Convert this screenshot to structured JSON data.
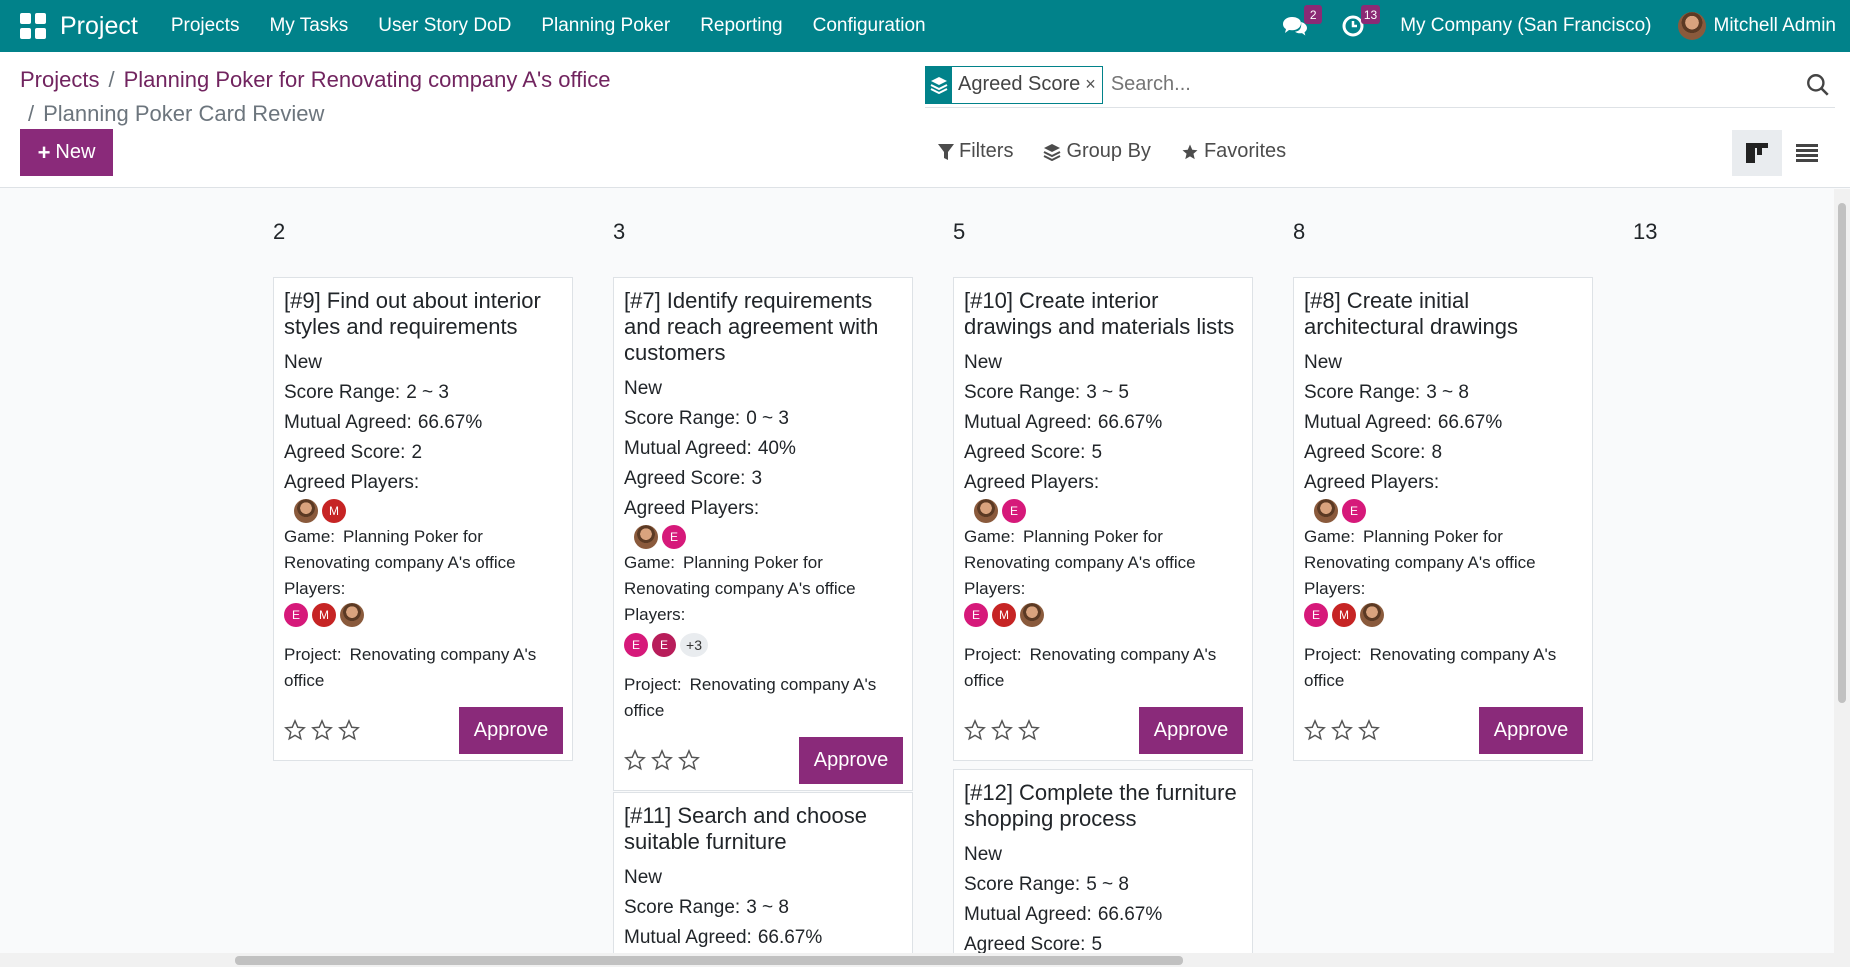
{
  "navbar": {
    "brand": "Project",
    "menu": [
      "Projects",
      "My Tasks",
      "User Story DoD",
      "Planning Poker",
      "Reporting",
      "Configuration"
    ],
    "messages_count": "2",
    "activities_count": "13",
    "company": "My Company (San Francisco)",
    "user": "Mitchell Admin"
  },
  "breadcrumb": {
    "root": "Projects",
    "parent": "Planning Poker for Renovating company A's office",
    "current": "Planning Poker Card Review"
  },
  "toolbar": {
    "new_label": "New"
  },
  "search": {
    "facet_label": "Agreed Score",
    "placeholder": "Search..."
  },
  "filters": {
    "filters": "Filters",
    "group_by": "Group By",
    "favorites": "Favorites"
  },
  "labels": {
    "score_range": "Score Range:",
    "mutual_agreed": "Mutual Agreed:",
    "agreed_score": "Agreed Score:",
    "agreed_players": "Agreed Players:",
    "game": "Game:",
    "players": "Players:",
    "project": "Project:",
    "approve": "Approve"
  },
  "columns": [
    {
      "title": "2",
      "cards": [
        {
          "title": "[#9] Find out about interior styles and requirements",
          "stage": "New",
          "score_range": "2 ~ 3",
          "mutual_agreed": "66.67%",
          "agreed_score": "2",
          "game_value": "Planning Poker for",
          "game_value2": "Renovating company A's office",
          "project_value": "Renovating company A's",
          "project_value2": "office"
        }
      ]
    },
    {
      "title": "3",
      "cards": [
        {
          "title": "[#7] Identify requirements and reach agreement with customers",
          "stage": "New",
          "score_range": "0 ~ 3",
          "mutual_agreed": "40%",
          "agreed_score": "3",
          "game_value": "Planning Poker for",
          "game_value2": "Renovating company A's office",
          "players_more": "+3",
          "project_value": "Renovating company A's",
          "project_value2": "office"
        },
        {
          "title": "[#11] Search and choose suitable furniture",
          "stage": "New",
          "score_range": "3 ~ 8",
          "mutual_agreed": "66.67%"
        }
      ]
    },
    {
      "title": "5",
      "cards": [
        {
          "title": "[#10] Create interior drawings and materials lists",
          "stage": "New",
          "score_range": "3 ~ 5",
          "mutual_agreed": "66.67%",
          "agreed_score": "5",
          "game_value": "Planning Poker for",
          "game_value2": "Renovating company A's office",
          "project_value": "Renovating company A's",
          "project_value2": "office"
        },
        {
          "title": "[#12] Complete the furniture shopping process",
          "stage": "New",
          "score_range": "5 ~ 8",
          "mutual_agreed": "66.67%",
          "agreed_score": "5"
        }
      ]
    },
    {
      "title": "8",
      "cards": [
        {
          "title": "[#8] Create initial architectural drawings",
          "stage": "New",
          "score_range": "3 ~ 8",
          "mutual_agreed": "66.67%",
          "agreed_score": "8",
          "game_value": "Planning Poker for",
          "game_value2": "Renovating company A's office",
          "project_value": "Renovating company A's",
          "project_value2": "office"
        }
      ]
    },
    {
      "title": "13",
      "cards": []
    }
  ],
  "avatar_letters": {
    "e": "E",
    "m": "M"
  },
  "colors": {
    "navbar": "#01828a",
    "primary": "#8a2a7a",
    "link": "#71245f"
  }
}
